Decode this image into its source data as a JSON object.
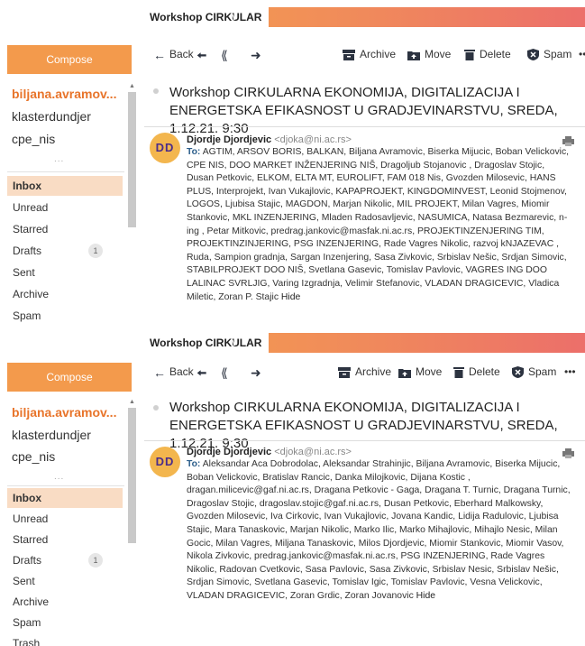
{
  "tab": {
    "title": "Workshop CIRKULAR",
    "chevron": "chevron-down-icon"
  },
  "sidebar": {
    "compose": "Compose",
    "accounts": [
      "biljana.avramov...",
      "klasterdundjer",
      "cpe_nis"
    ],
    "more": "...",
    "folders": [
      {
        "label": "Inbox",
        "active": true
      },
      {
        "label": "Unread"
      },
      {
        "label": "Starred"
      },
      {
        "label": "Drafts",
        "badge": "1"
      },
      {
        "label": "Sent"
      },
      {
        "label": "Archive"
      },
      {
        "label": "Spam"
      },
      {
        "label": "Trash"
      }
    ]
  },
  "toolbar": {
    "back": "Back",
    "archive": "Archive",
    "move": "Move",
    "delete": "Delete",
    "spam": "Spam",
    "more": "•••"
  },
  "message": {
    "subject": "Workshop CIRKULARNA EKONOMIJA, DIGITALIZACIJA I ENERGETSKA EFIKASNOST U GRADJEVINARSTVU, SREDA, 1.12.21. 9:30",
    "avatar": "DD",
    "sender_name": "Djordje Djordjevic",
    "sender_email": "<djoka@ni.ac.rs>",
    "to_label": "To:",
    "hide": "Hide"
  },
  "panel1_recipients": "AGTIM,  ARSOV BORIS,  BALKAN,  Biljana Avramovic,  Biserka Mijucic,  Boban Velickovic,  CPE NIS,  DOO MARKET INŽENJERING NIŠ,  Dragoljub Stojanovic ,  Dragoslav Stojic,  Dusan Petkovic,  ELKOM,  ELTA MT,  EUROLIFT,  FAM 018 Nis,  Gvozden Milosevic,  HANS PLUS,  Interprojekt,  Ivan Vukajlovic,  KAPAPROJEKT,  KINGDOMINVEST,  Leonid Stojmenov,  LOGOS,  Ljubisa Stajic,  MAGDON,  Marjan Nikolic,  MIL PROJEKT,  Milan Vagres,  Miomir Stankovic,  MKL INZENJERING,  Mladen Radosavljevic,  NASUMICA,  Natasa Bezmarevic,  n-ing ,  Petar Mitkovic,  predrag.jankovic@masfak.ni.ac.rs,  PROJEKTINZENJERING TIM,  PROJEKTINZINJERING,  PSG INZENJERING,  Rade Vagres Nikolic,  razvoj kNJAZEVAC ,  Ruda,  Sampion gradnja,  Sargan Inzenjering,  Sasa Zivkovic,  Srbislav Nešic,  Srdjan Simovic,  STABILPROJEKT DOO NIŠ,  Svetlana Gasevic,  Tomislav Pavlovic,  VAGRES ING DOO LALINAC SVRLJIG,  Varing Izgradnja,  Velimir Stefanovic,  VLADAN DRAGICEVIC,  Vladica Miletic,  Zoran P. Stajic",
  "panel2_recipients": "Aleksandar Aca Dobrodolac,  Aleksandar Strahinjic,  Biljana Avramovic,  Biserka Mijucic,  Boban Velickovic,  Bratislav Rancic,  Danka Milojkovic,  Dijana Kostic ,  dragan.milicevic@gaf.ni.ac.rs,  Dragana Petkovic - Gaga,  Dragana T. Turnic,  Dragana Turnic,  Dragoslav Stojic,  dragoslav.stojic@gaf.ni.ac.rs,  Dusan Petkovic,  Eberhard Malkowsky,  Gvozden Milosevic,  Iva Cirkovic,  Ivan Vukajlovic,  Jovana Kandic,  Lidija Radulovic,  Ljubisa Stajic,  Mara Tanaskovic,  Marjan Nikolic,  Marko Ilic,  Marko Mihajlovic,  Mihajlo Nesic,  Milan Gocic,  Milan Vagres,  Miljana Tanaskovic,  Milos Djordjevic,  Miomir Stankovic,  Miomir Vasov,  Nikola Zivkovic,  predrag.jankovic@masfak.ni.ac.rs,  PSG INZENJERING,  Rade Vagres Nikolic,  Radovan Cvetkovic,  Sasa Pavlovic,  Sasa Zivkovic,  Srbislav Nesic,  Srbislav Nešic,  Srdjan Simovic,  Svetlana Gasevic,  Tomislav Igic,  Tomislav Pavlovic,  Vesna Velickovic,  VLADAN DRAGICEVIC,  Zoran Grdic,  Zoran Jovanovic",
  "colors": {
    "accent": "#f39a4c",
    "active_folder_bg": "#f9dcc4",
    "account_active": "#e8742a",
    "avatar_bg": "#f3b64e",
    "to_label": "#2b5d8a"
  }
}
